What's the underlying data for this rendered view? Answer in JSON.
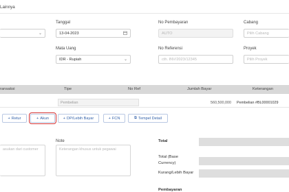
{
  "tab": {
    "label": "Lainnya"
  },
  "form": {
    "tanggal": {
      "label": "Tanggal",
      "value": "13-04-2023",
      "icon": "calendar-icon"
    },
    "no_pembayaran": {
      "label": "No Pembayaran",
      "value": "AUTO"
    },
    "cabang": {
      "label": "Cabang",
      "placeholder": "Pilih Cabang"
    },
    "mata_uang": {
      "label": "Mata Uang",
      "value": "IDR - Rupiah"
    },
    "no_referensi": {
      "label": "No Referensi",
      "placeholder": "cth. INV/2023/12345"
    },
    "proyek": {
      "label": "Proyek",
      "placeholder": "Pilih Proyek"
    }
  },
  "table": {
    "headers": [
      "ransaksi",
      "Tipe",
      "No Ref",
      "Jumlah Bayar",
      "Keterangan"
    ],
    "row": {
      "tipe": "Pembelian",
      "jumlah": "560,500,000",
      "keterangan": "Pembelian #BL00001029"
    }
  },
  "actions": {
    "retur": "Retur",
    "akun": "Akun",
    "dp": "DP/Lebih Bayar",
    "fcn": "FCN",
    "tempel": "Tempel Detail"
  },
  "notes": {
    "left_placeholder": "asukan dari customer",
    "note_label": "Note",
    "note_placeholder": "Keterangan khusus untuk pegawai"
  },
  "totals": {
    "total": "Total",
    "total_base_1": "Total (Base",
    "total_base_2": "Currency)",
    "kurang": "Kurang/Lebih Bayar",
    "pembayaran": "Pembayaran"
  },
  "colors": {
    "accent": "#2f5fa8",
    "highlight": "#d53030"
  }
}
